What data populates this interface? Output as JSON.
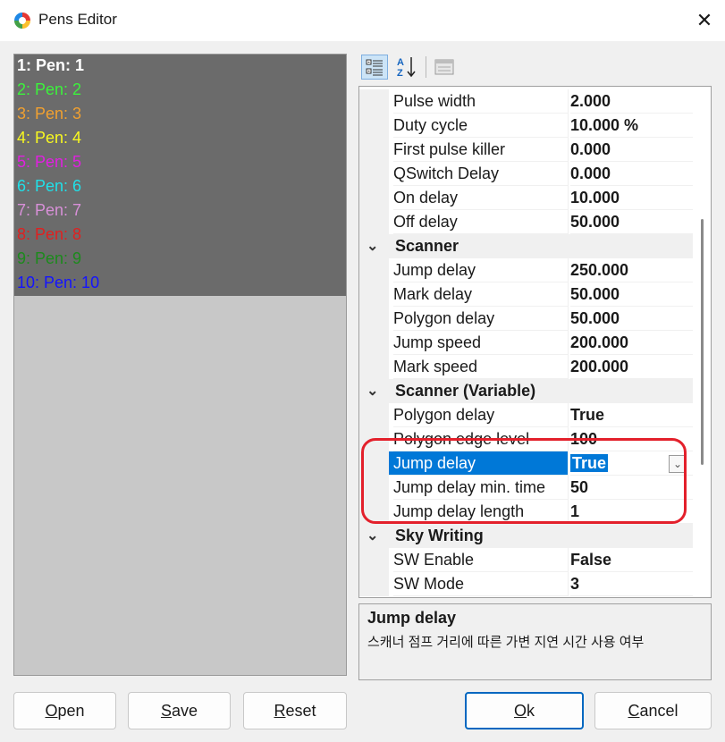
{
  "window": {
    "title": "Pens Editor",
    "close_label": "✕"
  },
  "pen_list": {
    "items": [
      {
        "label": "1: Pen: 1",
        "color": "#ffffff",
        "bold": true
      },
      {
        "label": "2: Pen: 2",
        "color": "#3cf23c"
      },
      {
        "label": "3: Pen: 3",
        "color": "#f0a030"
      },
      {
        "label": "4: Pen: 4",
        "color": "#f8f820"
      },
      {
        "label": "5: Pen: 5",
        "color": "#e020e0"
      },
      {
        "label": "6: Pen: 6",
        "color": "#20e0e8"
      },
      {
        "label": "7: Pen: 7",
        "color": "#d890d8"
      },
      {
        "label": "8: Pen: 8",
        "color": "#e02020"
      },
      {
        "label": "9: Pen: 9",
        "color": "#1c8a1c"
      },
      {
        "label": "10: Pen: 10",
        "color": "#1414ff"
      }
    ]
  },
  "toolbar": {
    "categorized_icon": "categorized-icon",
    "alphabetical_icon": "sort-alpha-icon",
    "property_pages_icon": "property-pages-icon"
  },
  "grid": {
    "rows": [
      {
        "type": "prop",
        "name": "Pulse width",
        "value": "2.000"
      },
      {
        "type": "prop",
        "name": "Duty cycle",
        "value": "10.000 %"
      },
      {
        "type": "prop",
        "name": "First pulse killer",
        "value": "0.000"
      },
      {
        "type": "prop",
        "name": "QSwitch Delay",
        "value": "0.000"
      },
      {
        "type": "prop",
        "name": "On delay",
        "value": "10.000"
      },
      {
        "type": "prop",
        "name": "Off delay",
        "value": "50.000"
      },
      {
        "type": "cat",
        "name": "Scanner"
      },
      {
        "type": "prop",
        "name": "Jump delay",
        "value": "250.000"
      },
      {
        "type": "prop",
        "name": "Mark delay",
        "value": "50.000"
      },
      {
        "type": "prop",
        "name": "Polygon delay",
        "value": "50.000"
      },
      {
        "type": "prop",
        "name": "Jump speed",
        "value": "200.000"
      },
      {
        "type": "prop",
        "name": "Mark speed",
        "value": "200.000"
      },
      {
        "type": "cat",
        "name": "Scanner (Variable)"
      },
      {
        "type": "prop",
        "name": "Polygon delay",
        "value": "True"
      },
      {
        "type": "prop",
        "name": "Polygon edge level",
        "value": "100"
      },
      {
        "type": "prop",
        "name": "Jump delay",
        "value": "True",
        "selected": true
      },
      {
        "type": "prop",
        "name": "Jump delay min. time",
        "value": "50"
      },
      {
        "type": "prop",
        "name": "Jump delay length",
        "value": "1"
      },
      {
        "type": "cat",
        "name": "Sky Writing"
      },
      {
        "type": "prop",
        "name": "SW Enable",
        "value": "False"
      },
      {
        "type": "prop",
        "name": "SW Mode",
        "value": "3"
      }
    ],
    "collapse_icon": "chevron-down-icon"
  },
  "help": {
    "title": "Jump delay",
    "description": "스캐너 점프 거리에 따른 가변 지연 시간 사용 여부"
  },
  "buttons": {
    "open": {
      "accel": "O",
      "rest": "pen"
    },
    "save": {
      "accel": "S",
      "rest": "ave"
    },
    "reset": {
      "accel": "R",
      "rest": "eset"
    },
    "ok": {
      "accel": "O",
      "rest": "k"
    },
    "cancel": {
      "accel": "C",
      "rest": "ancel"
    }
  },
  "colors": {
    "selection": "#0078d7",
    "highlight_outline": "#e3202b",
    "accent": "#0067c0"
  }
}
